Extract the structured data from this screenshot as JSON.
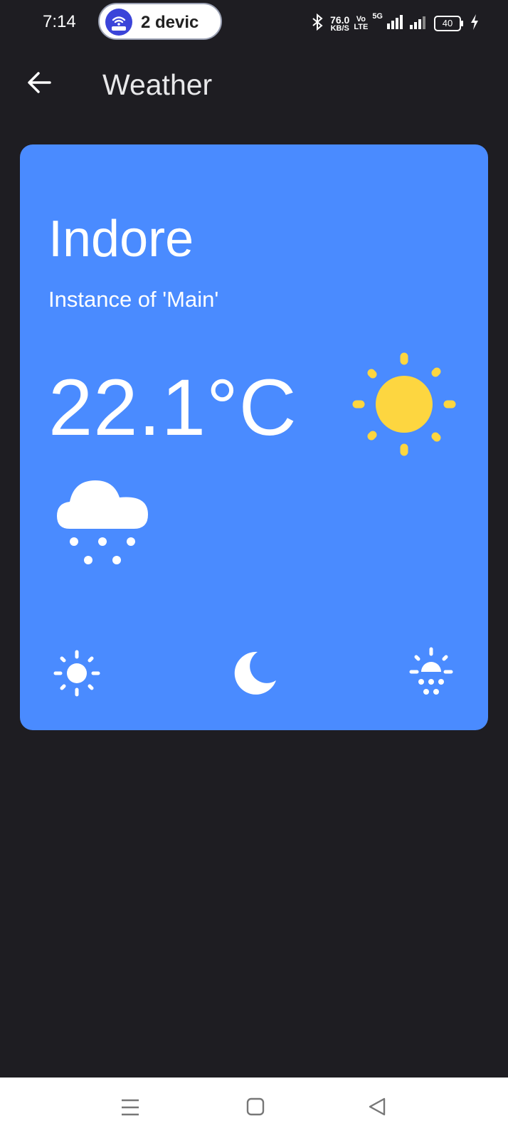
{
  "status_bar": {
    "time": "7:14",
    "hotspot_label": "2 devic",
    "net_speed_value": "76.0",
    "net_speed_unit": "KB/S",
    "volte": "Vo",
    "lte": "LTE",
    "network": "5G",
    "battery": "40"
  },
  "app_bar": {
    "title": "Weather"
  },
  "card": {
    "city": "Indore",
    "subtitle": "Instance of 'Main'",
    "temperature": "22.1°C"
  },
  "colors": {
    "background": "#1e1d22",
    "card": "#4a8bff",
    "sun": "#fdd640",
    "icon": "#ffffff"
  },
  "icons": {
    "back": "arrow-left-icon",
    "large": "sun-icon",
    "secondary": "cloud-snow-icon",
    "bottom": [
      "sun-icon",
      "moon-icon",
      "sunrise-snow-icon"
    ]
  }
}
